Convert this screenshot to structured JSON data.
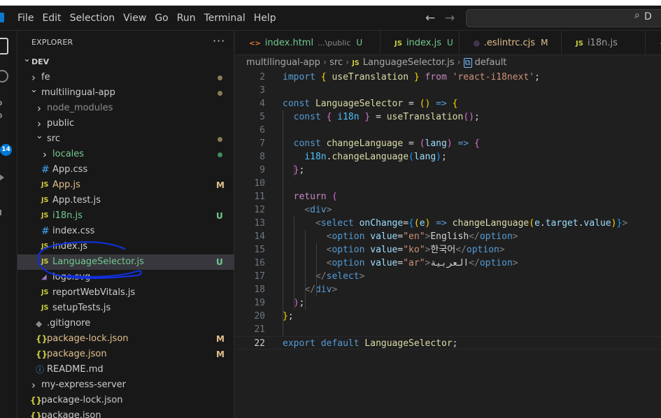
{
  "menu": [
    "File",
    "Edit",
    "Selection",
    "View",
    "Go",
    "Run",
    "Terminal",
    "Help"
  ],
  "search_label": "D",
  "activity": {
    "scm_badge": "14"
  },
  "sidebar": {
    "title": "EXPLORER",
    "more": "···",
    "tree": [
      {
        "label": "DEV",
        "kind": "root-open",
        "depth": 0
      },
      {
        "label": "fe",
        "kind": "folder-closed",
        "depth": 1,
        "dot": "mod"
      },
      {
        "label": "multilingual-app",
        "kind": "folder-open",
        "depth": 1,
        "dot": "mod"
      },
      {
        "label": "node_modules",
        "kind": "folder-closed",
        "depth": 2,
        "dim": true
      },
      {
        "label": "public",
        "kind": "folder-closed",
        "depth": 2
      },
      {
        "label": "src",
        "kind": "folder-open",
        "depth": 2,
        "dot": "mod"
      },
      {
        "label": "locales",
        "kind": "folder-closed",
        "depth": 3,
        "status": "untracked",
        "dot": "unt"
      },
      {
        "label": "App.css",
        "kind": "file",
        "icon": "css",
        "depth": 3
      },
      {
        "label": "App.js",
        "kind": "file",
        "icon": "js",
        "depth": 3,
        "status": "modified",
        "badge": "M"
      },
      {
        "label": "App.test.js",
        "kind": "file",
        "icon": "jsr",
        "depth": 3
      },
      {
        "label": "i18n.js",
        "kind": "file",
        "icon": "js",
        "depth": 3,
        "status": "untracked",
        "badge": "U"
      },
      {
        "label": "index.css",
        "kind": "file",
        "icon": "css",
        "depth": 3
      },
      {
        "label": "index.js",
        "kind": "file",
        "icon": "js",
        "depth": 3
      },
      {
        "label": "LanguageSelector.js",
        "kind": "file",
        "icon": "js",
        "depth": 3,
        "status": "untracked",
        "badge": "U",
        "selected": true
      },
      {
        "label": "logo.svg",
        "kind": "file",
        "icon": "svg",
        "depth": 3
      },
      {
        "label": "reportWebVitals.js",
        "kind": "file",
        "icon": "js",
        "depth": 3
      },
      {
        "label": "setupTests.js",
        "kind": "file",
        "icon": "js",
        "depth": 3
      },
      {
        "label": ".gitignore",
        "kind": "file",
        "icon": "git",
        "depth": 2
      },
      {
        "label": "package-lock.json",
        "kind": "file",
        "icon": "json",
        "depth": 2,
        "status": "modified",
        "badge": "M"
      },
      {
        "label": "package.json",
        "kind": "file",
        "icon": "json",
        "depth": 2,
        "status": "modified",
        "badge": "M"
      },
      {
        "label": "README.md",
        "kind": "file",
        "icon": "info",
        "depth": 2
      },
      {
        "label": "my-express-server",
        "kind": "folder-closed",
        "depth": 1
      },
      {
        "label": "package-lock.json",
        "kind": "file",
        "icon": "json",
        "depth": 1
      },
      {
        "label": "package.json",
        "kind": "file",
        "icon": "json",
        "depth": 1
      }
    ]
  },
  "tabs": [
    {
      "label": "index.html",
      "path": "...\\public",
      "status": "U",
      "icon": "html"
    },
    {
      "label": "index.js",
      "status": "U",
      "icon": "js"
    },
    {
      "label": ".eslintrc.cjs",
      "status": "M",
      "icon": "eslint"
    },
    {
      "label": "i18n.js",
      "status": "",
      "icon": "js"
    },
    {
      "label": "",
      "status": "",
      "icon": "json"
    }
  ],
  "icon_glyphs": {
    "js": "JS",
    "jsr": "JS",
    "css": "#",
    "json": "{}",
    "info": "ⓘ",
    "git": "◆",
    "svg": "◢",
    "html": "<>",
    "eslint": "◎"
  },
  "breadcrumb": [
    "multilingual-app",
    "src",
    "LanguageSelector.js",
    "default"
  ],
  "editor": {
    "current_line": 22,
    "lines": [
      {
        "n": "2",
        "t": [
          [
            "t-kw",
            "import"
          ],
          [
            "t-plain",
            " "
          ],
          [
            "t-br1",
            "{"
          ],
          [
            "t-plain",
            " "
          ],
          [
            "t-fn",
            "useTranslation"
          ],
          [
            "t-plain",
            " "
          ],
          [
            "t-br1",
            "}"
          ],
          [
            "t-plain",
            " "
          ],
          [
            "t-ctl",
            "from"
          ],
          [
            "t-plain",
            " "
          ],
          [
            "t-str",
            "'react-i18next'"
          ],
          [
            "t-plain",
            ";"
          ]
        ]
      },
      {
        "n": "3",
        "t": []
      },
      {
        "n": "4",
        "t": [
          [
            "t-kw",
            "const"
          ],
          [
            "t-plain",
            " "
          ],
          [
            "t-fn",
            "LanguageSelector"
          ],
          [
            "t-plain",
            " = "
          ],
          [
            "t-br1",
            "()"
          ],
          [
            "t-plain",
            " "
          ],
          [
            "t-kw",
            "=>"
          ],
          [
            "t-plain",
            " "
          ],
          [
            "t-br1",
            "{"
          ]
        ]
      },
      {
        "n": "5",
        "t": [
          [
            "t-plain",
            "  "
          ],
          [
            "t-kw",
            "const"
          ],
          [
            "t-plain",
            " "
          ],
          [
            "t-br2",
            "{"
          ],
          [
            "t-plain",
            " "
          ],
          [
            "t-const",
            "i18n"
          ],
          [
            "t-plain",
            " "
          ],
          [
            "t-br2",
            "}"
          ],
          [
            "t-plain",
            " = "
          ],
          [
            "t-fn",
            "useTranslation"
          ],
          [
            "t-br2",
            "()"
          ],
          [
            "t-plain",
            ";"
          ]
        ]
      },
      {
        "n": "6",
        "t": []
      },
      {
        "n": "7",
        "t": [
          [
            "t-plain",
            "  "
          ],
          [
            "t-kw",
            "const"
          ],
          [
            "t-plain",
            " "
          ],
          [
            "t-fn",
            "changeLanguage"
          ],
          [
            "t-plain",
            " = "
          ],
          [
            "t-br2",
            "("
          ],
          [
            "t-var",
            "lang"
          ],
          [
            "t-br2",
            ")"
          ],
          [
            "t-plain",
            " "
          ],
          [
            "t-kw",
            "=>"
          ],
          [
            "t-plain",
            " "
          ],
          [
            "t-br2",
            "{"
          ]
        ]
      },
      {
        "n": "8",
        "t": [
          [
            "t-plain",
            "    "
          ],
          [
            "t-const",
            "i18n"
          ],
          [
            "t-plain",
            "."
          ],
          [
            "t-fn",
            "changeLanguage"
          ],
          [
            "t-br3",
            "("
          ],
          [
            "t-var",
            "lang"
          ],
          [
            "t-br3",
            ")"
          ],
          [
            "t-plain",
            ";"
          ]
        ]
      },
      {
        "n": "9",
        "t": [
          [
            "t-plain",
            "  "
          ],
          [
            "t-br2",
            "}"
          ],
          [
            "t-plain",
            ";"
          ]
        ]
      },
      {
        "n": "10",
        "t": []
      },
      {
        "n": "11",
        "t": [
          [
            "t-plain",
            "  "
          ],
          [
            "t-ctl",
            "return"
          ],
          [
            "t-plain",
            " "
          ],
          [
            "t-br2",
            "("
          ]
        ]
      },
      {
        "n": "12",
        "t": [
          [
            "t-plain",
            "    "
          ],
          [
            "t-punc",
            "<"
          ],
          [
            "t-tag",
            "div"
          ],
          [
            "t-punc",
            ">"
          ]
        ]
      },
      {
        "n": "13",
        "t": [
          [
            "t-plain",
            "      "
          ],
          [
            "t-punc",
            "<"
          ],
          [
            "t-tag",
            "select"
          ],
          [
            "t-plain",
            " "
          ],
          [
            "t-attr",
            "onChange"
          ],
          [
            "t-plain",
            "="
          ],
          [
            "t-br3",
            "{"
          ],
          [
            "t-br1",
            "("
          ],
          [
            "t-var",
            "e"
          ],
          [
            "t-br1",
            ")"
          ],
          [
            "t-plain",
            " "
          ],
          [
            "t-kw",
            "=>"
          ],
          [
            "t-plain",
            " "
          ],
          [
            "t-fn",
            "changeLanguage"
          ],
          [
            "t-br1",
            "("
          ],
          [
            "t-var",
            "e"
          ],
          [
            "t-plain",
            "."
          ],
          [
            "t-var",
            "target"
          ],
          [
            "t-plain",
            "."
          ],
          [
            "t-var",
            "value"
          ],
          [
            "t-br1",
            ")"
          ],
          [
            "t-br3",
            "}"
          ],
          [
            "t-punc",
            ">"
          ]
        ]
      },
      {
        "n": "14",
        "t": [
          [
            "t-plain",
            "        "
          ],
          [
            "t-punc",
            "<"
          ],
          [
            "t-tag",
            "option"
          ],
          [
            "t-plain",
            " "
          ],
          [
            "t-attr",
            "value"
          ],
          [
            "t-plain",
            "="
          ],
          [
            "t-str",
            "\"en\""
          ],
          [
            "t-punc",
            ">"
          ],
          [
            "t-txt",
            "English"
          ],
          [
            "t-punc",
            "</"
          ],
          [
            "t-tag",
            "option"
          ],
          [
            "t-punc",
            ">"
          ]
        ]
      },
      {
        "n": "15",
        "t": [
          [
            "t-plain",
            "        "
          ],
          [
            "t-punc",
            "<"
          ],
          [
            "t-tag",
            "option"
          ],
          [
            "t-plain",
            " "
          ],
          [
            "t-attr",
            "value"
          ],
          [
            "t-plain",
            "="
          ],
          [
            "t-str",
            "\"ko\""
          ],
          [
            "t-punc",
            ">"
          ],
          [
            "t-txt",
            "한국어"
          ],
          [
            "t-punc",
            "</"
          ],
          [
            "t-tag",
            "option"
          ],
          [
            "t-punc",
            ">"
          ]
        ]
      },
      {
        "n": "16",
        "t": [
          [
            "t-plain",
            "        "
          ],
          [
            "t-punc",
            "<"
          ],
          [
            "t-tag",
            "option"
          ],
          [
            "t-plain",
            " "
          ],
          [
            "t-attr",
            "value"
          ],
          [
            "t-plain",
            "="
          ],
          [
            "t-str",
            "\"ar\""
          ],
          [
            "t-punc",
            ">"
          ],
          [
            "t-txt",
            "العربية"
          ],
          [
            "t-punc",
            "</"
          ],
          [
            "t-tag",
            "option"
          ],
          [
            "t-punc",
            ">"
          ]
        ]
      },
      {
        "n": "17",
        "t": [
          [
            "t-plain",
            "      "
          ],
          [
            "t-punc",
            "</"
          ],
          [
            "t-tag",
            "select"
          ],
          [
            "t-punc",
            ">"
          ]
        ]
      },
      {
        "n": "18",
        "t": [
          [
            "t-plain",
            "    "
          ],
          [
            "t-punc",
            "</"
          ],
          [
            "t-tag",
            "div"
          ],
          [
            "t-punc",
            ">"
          ]
        ]
      },
      {
        "n": "19",
        "t": [
          [
            "t-plain",
            "  "
          ],
          [
            "t-br2",
            ")"
          ],
          [
            "t-plain",
            ";"
          ]
        ]
      },
      {
        "n": "20",
        "t": [
          [
            "t-br1",
            "}"
          ],
          [
            "t-plain",
            ";"
          ]
        ]
      },
      {
        "n": "21",
        "t": []
      },
      {
        "n": "22",
        "t": [
          [
            "t-kw",
            "export"
          ],
          [
            "t-plain",
            " "
          ],
          [
            "t-kw",
            "default"
          ],
          [
            "t-plain",
            " "
          ],
          [
            "t-fn",
            "LanguageSelector"
          ],
          [
            "t-plain",
            ";"
          ]
        ]
      }
    ]
  },
  "colors": {
    "accent": "#0078d4",
    "modified": "#e2c08d",
    "untracked": "#73c991",
    "annotation": "#1030d8"
  }
}
